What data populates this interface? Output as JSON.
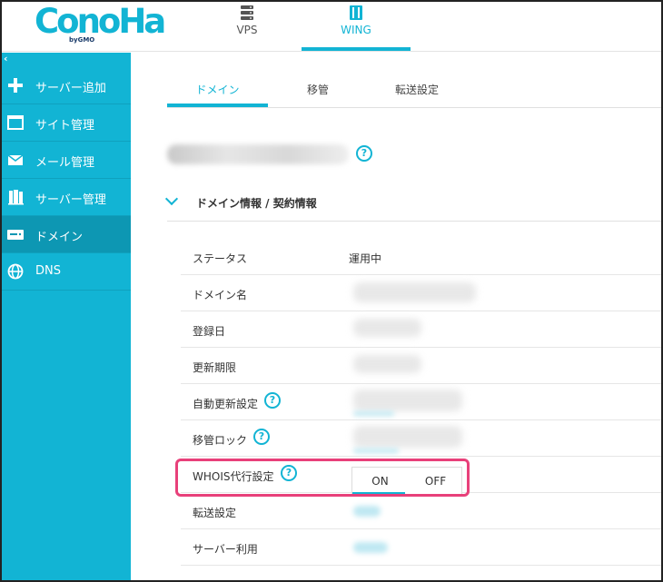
{
  "logo": {
    "text": "ConoHa",
    "sub": "byGMO"
  },
  "header_nav": [
    {
      "label": "VPS",
      "icon": "server-icon",
      "active": false
    },
    {
      "label": "WING",
      "icon": "wing-icon",
      "active": true
    }
  ],
  "sidebar": {
    "collapse_glyph": "‹",
    "items": [
      {
        "label": "サーバー追加",
        "icon": "plus-icon",
        "active": false
      },
      {
        "label": "サイト管理",
        "icon": "window-icon",
        "active": false
      },
      {
        "label": "メール管理",
        "icon": "mail-icon",
        "active": false
      },
      {
        "label": "サーバー管理",
        "icon": "server-stack-icon",
        "active": false
      },
      {
        "label": "ドメイン",
        "icon": "domain-icon",
        "active": true
      },
      {
        "label": "DNS",
        "icon": "globe-icon",
        "active": false
      }
    ]
  },
  "tabs": [
    {
      "label": "ドメイン",
      "active": true
    },
    {
      "label": "移管",
      "active": false
    },
    {
      "label": "転送設定",
      "active": false
    }
  ],
  "help_glyph": "?",
  "section": {
    "title": "ドメイン情報 / 契約情報"
  },
  "rows": [
    {
      "label": "ステータス",
      "value": "運用中"
    },
    {
      "label": "ドメイン名",
      "value": ""
    },
    {
      "label": "登録日",
      "value": ""
    },
    {
      "label": "更新期限",
      "value": ""
    },
    {
      "label": "自動更新設定",
      "value": ""
    },
    {
      "label": "移管ロック",
      "value": ""
    },
    {
      "label": "WHOIS代行設定",
      "value": ""
    },
    {
      "label": "転送設定",
      "value": ""
    },
    {
      "label": "サーバー利用",
      "value": ""
    }
  ],
  "whois_toggle": {
    "on_label": "ON",
    "off_label": "OFF",
    "selected": "ON"
  },
  "colors": {
    "accent": "#12b4d4",
    "highlight": "#e8407a",
    "sidebar_active": "#0d97b3"
  }
}
